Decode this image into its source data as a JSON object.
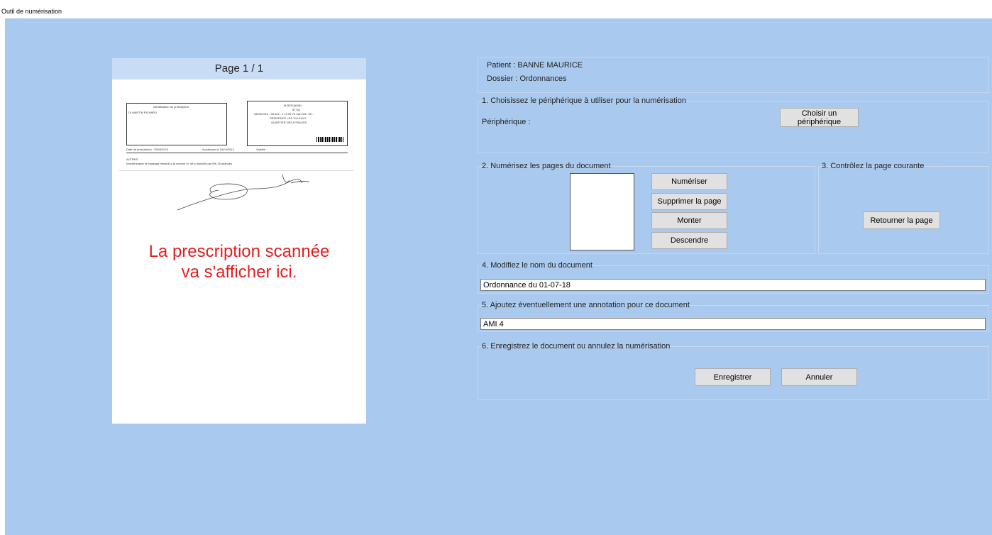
{
  "window": {
    "title": "Outil de numérisation"
  },
  "preview": {
    "page_label": "Page 1 / 1",
    "overlay_line1": "La prescription scannée",
    "overlay_line2": "va s'afficher ici.",
    "doc": {
      "prescriber_header": "Identification du prescripteur",
      "prescriber_name": "Dr MARTIN RICHARD",
      "patient_name": "M BENJAMIN",
      "patient_age": "87 Kg",
      "patient_line": "28/05/1919 - 93 ans - 1 19 06 75 118 244 / 06 -",
      "patient_address1": "RESIDENCE LES TILLEULS",
      "patient_address2": "QUARTIER DES EYRAUDS",
      "date_prescription": "Date de prescription : 25/03/2013",
      "a_pratiquer": "A pratiquer le 15/04/2013",
      "validite": "Validité :",
      "autres": "AUTRES",
      "acte": "kinesitherapie et massage medical a la marche m. inf a domicile par MK 30 seances"
    }
  },
  "info": {
    "patient": "Patient : BANNE MAURICE",
    "dossier": "Dossier : Ordonnances"
  },
  "step1": {
    "legend": "1. Choisissez le périphérique à utiliser pour la numérisation",
    "label": "Périphérique :",
    "button": "Choisir un périphérique"
  },
  "step2": {
    "legend": "2. Numérisez les pages du document",
    "scan": "Numériser",
    "delete": "Supprimer la page",
    "up": "Monter",
    "down": "Descendre"
  },
  "step3": {
    "legend": "3. Contrôlez la page courante",
    "rotate": "Retourner la page"
  },
  "step4": {
    "legend": "4. Modifiez le nom du document",
    "value": "Ordonnance du 01-07-18"
  },
  "step5": {
    "legend": "5. Ajoutez éventuellement une annotation pour ce document",
    "value": "AMI 4"
  },
  "step6": {
    "legend": "6. Enregistrez le document ou annulez la numérisation",
    "save": "Enregistrer",
    "cancel": "Annuler"
  },
  "colors": {
    "background": "#a9c9ef",
    "overlay_text": "#e02020",
    "page_header": "#c9dcf6"
  }
}
